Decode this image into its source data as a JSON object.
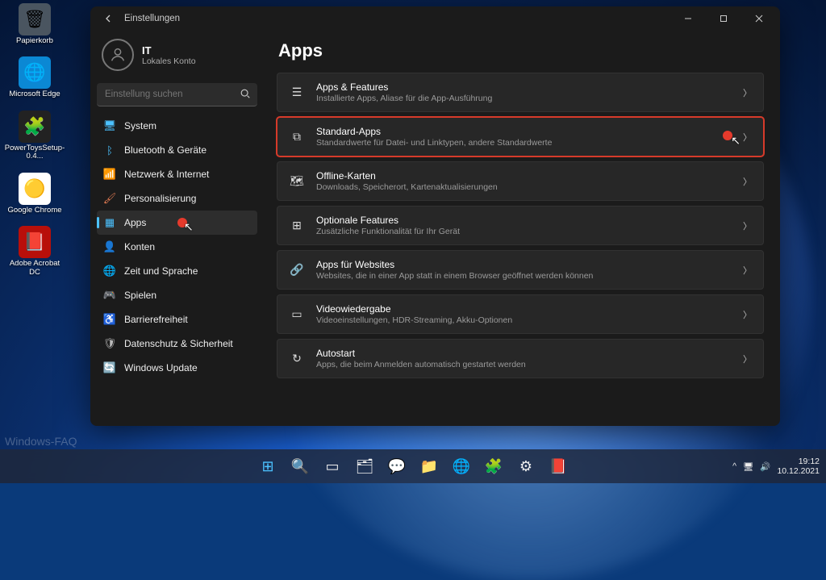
{
  "desktop": {
    "icons": [
      {
        "label": "Papierkorb",
        "bg": "#4a5560",
        "glyph": "🗑"
      },
      {
        "label": "Microsoft Edge",
        "bg": "#0b88d4",
        "glyph": "🌐"
      },
      {
        "label": "PowerToysSetup-0.4...",
        "bg": "#222",
        "glyph": "🧩"
      },
      {
        "label": "Google Chrome",
        "bg": "#fff",
        "glyph": "🟡"
      },
      {
        "label": "Adobe Acrobat DC",
        "bg": "#b80f0a",
        "glyph": "📕"
      }
    ],
    "watermark": "Windows-FAQ"
  },
  "window": {
    "title": "Einstellungen",
    "user": {
      "name": "IT",
      "subtitle": "Lokales Konto"
    },
    "search_placeholder": "Einstellung suchen",
    "nav": [
      {
        "label": "System",
        "glyph": "🖥",
        "color": "#4cc2ff"
      },
      {
        "label": "Bluetooth & Geräte",
        "glyph": "ᛒ",
        "color": "#4cc2ff"
      },
      {
        "label": "Netzwerk & Internet",
        "glyph": "📶",
        "color": "#4cc2ff"
      },
      {
        "label": "Personalisierung",
        "glyph": "🖌",
        "color": "#e07a52"
      },
      {
        "label": "Apps",
        "glyph": "▦",
        "color": "#4cc2ff",
        "active": true,
        "dot": true
      },
      {
        "label": "Konten",
        "glyph": "👤",
        "color": "#8fbf6b"
      },
      {
        "label": "Zeit und Sprache",
        "glyph": "🌐",
        "color": "#bbb"
      },
      {
        "label": "Spielen",
        "glyph": "🎮",
        "color": "#bbb"
      },
      {
        "label": "Barrierefreiheit",
        "glyph": "♿",
        "color": "#6aa0e0"
      },
      {
        "label": "Datenschutz & Sicherheit",
        "glyph": "🛡",
        "color": "#bbb"
      },
      {
        "label": "Windows Update",
        "glyph": "🔄",
        "color": "#4cc2ff"
      }
    ],
    "page_title": "Apps",
    "cards": [
      {
        "title": "Apps & Features",
        "desc": "Installierte Apps, Aliase für die App-Ausführung",
        "glyph": "☰"
      },
      {
        "title": "Standard-Apps",
        "desc": "Standardwerte für Datei- und Linktypen, andere Standardwerte",
        "glyph": "⧉",
        "highlight": true,
        "dot": true
      },
      {
        "title": "Offline-Karten",
        "desc": "Downloads, Speicherort, Kartenaktualisierungen",
        "glyph": "🗺"
      },
      {
        "title": "Optionale Features",
        "desc": "Zusätzliche Funktionalität für Ihr Gerät",
        "glyph": "⊞"
      },
      {
        "title": "Apps für Websites",
        "desc": "Websites, die in einer App statt in einem Browser geöffnet werden können",
        "glyph": "🔗"
      },
      {
        "title": "Videowiedergabe",
        "desc": "Videoeinstellungen, HDR-Streaming, Akku-Optionen",
        "glyph": "▭"
      },
      {
        "title": "Autostart",
        "desc": "Apps, die beim Anmelden automatisch gestartet werden",
        "glyph": "↻"
      }
    ]
  },
  "taskbar": {
    "items": [
      {
        "name": "start",
        "glyph": "⊞",
        "color": "#4cc2ff"
      },
      {
        "name": "search",
        "glyph": "🔍"
      },
      {
        "name": "taskview",
        "glyph": "▭"
      },
      {
        "name": "explorer",
        "glyph": "🗂"
      },
      {
        "name": "chat",
        "glyph": "💬",
        "color": "#6b5cff"
      },
      {
        "name": "files",
        "glyph": "📁"
      },
      {
        "name": "edge",
        "glyph": "🌐",
        "color": "#1b88d4"
      },
      {
        "name": "powertoys",
        "glyph": "🧩"
      },
      {
        "name": "settings",
        "glyph": "⚙"
      },
      {
        "name": "acrobat",
        "glyph": "📕"
      }
    ],
    "tray": {
      "chevron": "^",
      "net": "🖥",
      "vol": "🔊"
    },
    "time": "19:12",
    "date": "10.12.2021"
  }
}
